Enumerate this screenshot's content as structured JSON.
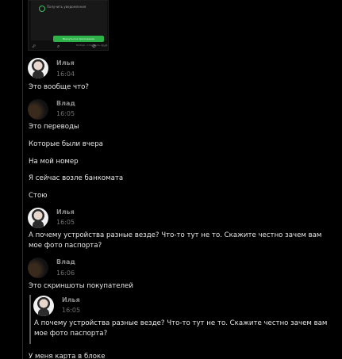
{
  "screenshot": {
    "checkbox_label": "Получить уведомления",
    "button_label": "Вернуться в приложение",
    "footer_note": "НАЗАД · отправить 20 05",
    "nav_icons": [
      "⬀",
      "⌕",
      "⊘",
      "⋯"
    ]
  },
  "messages": [
    {
      "author": "Илья",
      "time": "16:04",
      "lines": [
        "Это вообще что?"
      ]
    },
    {
      "author": "Влад",
      "time": "16:05",
      "lines": [
        "Это переводы",
        "Которые были вчера",
        "На мой номер",
        "Я сейчас возле банкомата",
        "Стою"
      ]
    },
    {
      "author": "Илья",
      "time": "16:05",
      "lines": [
        "А почему устройства разные везде? Что-то тут не то. Скажите честно зачем вам",
        "мое фото паспорта?"
      ]
    },
    {
      "author": "Влад",
      "time": "16:06",
      "lines": [
        "Это скриншоты покупателей"
      ]
    }
  ],
  "quote": {
    "author": "Илья",
    "time": "16:05",
    "lines": [
      "А почему устройства разные везде? Что-то тут не то. Скажите честно зачем вам",
      "мое фото паспорта?"
    ]
  },
  "trailing": "У меня карта в блоке"
}
